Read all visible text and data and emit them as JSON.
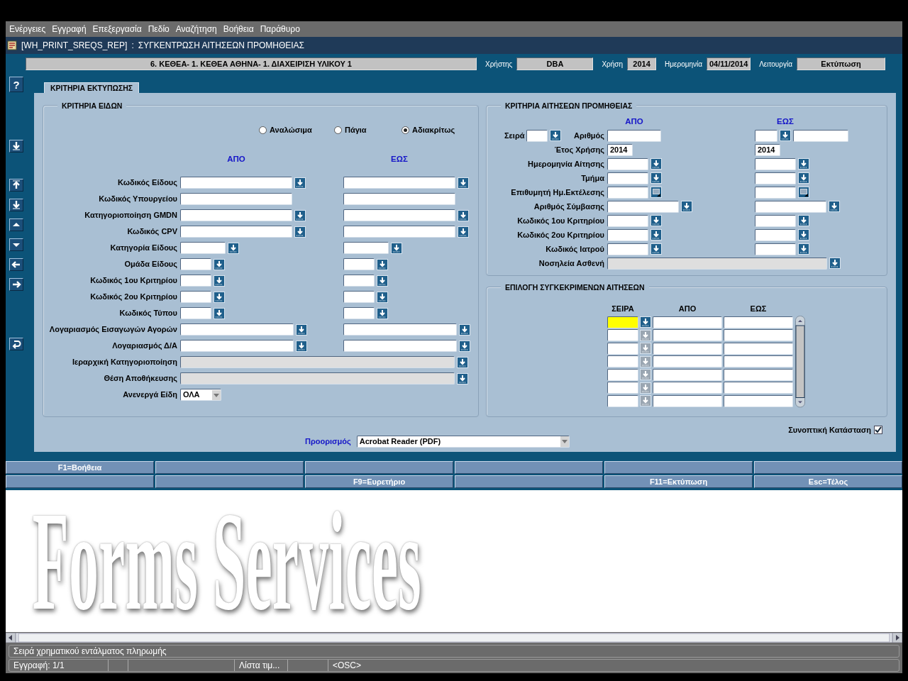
{
  "menu": [
    "Ενέργειες",
    "Εγγραφή",
    "Επεξεργασία",
    "Πεδίο",
    "Αναζήτηση",
    "Βοήθεια",
    "Παράθυρο"
  ],
  "window": {
    "form_name": "[WH_PRINT_SREQS_REP]",
    "separator": ":",
    "title": "ΣΥΓΚΕΝΤΡΩΣΗ ΑΙΤΗΣΕΩΝ ΠΡΟΜΗΘΕΙΑΣ"
  },
  "header": {
    "context": "6. ΚΕΘΕΑ- 1. ΚΕΘΕΑ ΑΘΗΝΑ- 1. ΔΙΑΧΕΙΡΙΣΗ ΥΛΙΚΟΥ 1",
    "fields": [
      {
        "label": "Χρήστης",
        "value": "DBA"
      },
      {
        "label": "Χρήση",
        "value": "2014"
      },
      {
        "label": "Ημερομηνία",
        "value": "04/11/2014"
      },
      {
        "label": "Λειτουργία",
        "value": "Εκτύπωση"
      }
    ]
  },
  "toolbar": [
    [
      {
        "kind": "help",
        "label": "?"
      }
    ],
    [
      {
        "kind": "down"
      }
    ],
    [
      {
        "kind": "up"
      },
      {
        "kind": "down"
      },
      {
        "kind": "prev"
      },
      {
        "kind": "next"
      },
      {
        "kind": "left"
      },
      {
        "kind": "right"
      }
    ],
    [
      {
        "kind": "undo"
      }
    ]
  ],
  "tab": {
    "label": "ΚΡΙΤΗΡΙΑ ΕΚΤΥΠΩΣΗΣ",
    "selected": true
  },
  "items_panel": {
    "title": "ΚΡΙΤΗΡΙΑ ΕΙΔΩΝ",
    "radios": [
      {
        "label": "Αναλώσιμα",
        "selected": false
      },
      {
        "label": "Πάγια",
        "selected": false
      },
      {
        "label": "Αδιακρίτως",
        "selected": true
      }
    ],
    "from_heading": "ΑΠΟ",
    "to_heading": "ΕΩΣ",
    "rows": [
      {
        "label": "Κωδικός Είδους",
        "kind": "range",
        "list_button": true
      },
      {
        "label": "Κωδικός Υπουργείου",
        "kind": "range",
        "list_button": false
      },
      {
        "label": "Κατηγοριοποίηση GMDN",
        "kind": "range",
        "list_button": true
      },
      {
        "label": "Κωδικός CPV",
        "kind": "range",
        "list_button": true
      },
      {
        "label": "Κατηγορία Είδους",
        "kind": "range",
        "list_button": true
      },
      {
        "label": "Ομάδα Είδους",
        "kind": "range",
        "list_button": true
      },
      {
        "label": "Κωδικός 1ου Κριτηρίου",
        "kind": "range",
        "list_button": true
      },
      {
        "label": "Κωδικός 2ου Κριτηρίου",
        "kind": "range",
        "list_button": true
      },
      {
        "label": "Κωδικός Τύπου",
        "kind": "range",
        "list_button": true
      },
      {
        "label": "Λογαριασμός Εισαγωγών Αγορών",
        "kind": "range",
        "list_button": true
      },
      {
        "label": "Λογαριασμός Δ/Α",
        "kind": "range",
        "list_button": true
      },
      {
        "label": "Ιεραρχική Κατηγοριοποίηση",
        "kind": "wide",
        "list_button": true
      },
      {
        "label": "Θέση Αποθήκευσης",
        "kind": "wide",
        "list_button": true
      },
      {
        "label": "Ανενεργά Είδη",
        "kind": "select",
        "value": "ΟΛΑ"
      }
    ]
  },
  "requests_panel": {
    "title": "ΚΡΙΤΗΡΙΑ ΑΙΤΗΣΕΩΝ ΠΡΟΜΗΘΕΙΑΣ",
    "from_heading": "ΑΠΟ",
    "to_heading": "ΕΩΣ",
    "rows": [
      {
        "label": "Σειρά",
        "second_label": "Αριθμός",
        "kind": "series"
      },
      {
        "label": "Έτος Χρήσης",
        "kind": "range",
        "from_value": "2014",
        "to_value": "2014",
        "list_button": false
      },
      {
        "label": "Ημερομηνία Αίτησης",
        "kind": "range",
        "list_button": true
      },
      {
        "label": "Τμήμα",
        "kind": "range",
        "list_button": true
      },
      {
        "label": "Επιθυμητή Ημ.Εκτέλεσης",
        "kind": "range",
        "calendar_button": true
      },
      {
        "label": "Αριθμός Σύμβασης",
        "kind": "range",
        "list_button": true
      },
      {
        "label": "Κωδικός 1ου Κριτηρίου",
        "kind": "range",
        "list_button": true
      },
      {
        "label": "Κωδικός 2ου Κριτηρίου",
        "kind": "range",
        "list_button": true
      },
      {
        "label": "Κωδικός Ιατρού",
        "kind": "range",
        "list_button": true
      },
      {
        "label": "Νοσηλεία Ασθενή",
        "kind": "wide",
        "list_button": true
      }
    ]
  },
  "selection_panel": {
    "title": "ΕΠΙΛΟΓΗ ΣΥΓΚΕΚΡΙΜΕΝΩΝ ΑΙΤΗΣΕΩΝ",
    "columns": [
      "ΣΕΙΡΑ",
      "ΑΠΟ",
      "ΕΩΣ"
    ],
    "rows": [
      {
        "selected": true
      },
      {
        "selected": false
      },
      {
        "selected": false
      },
      {
        "selected": false
      },
      {
        "selected": false
      },
      {
        "selected": false
      },
      {
        "selected": false
      }
    ]
  },
  "summary": {
    "label": "Συνοπτική Κατάσταση",
    "checked": true
  },
  "destination": {
    "label": "Προορισμός",
    "value": "Acrobat Reader (PDF)"
  },
  "function_keys": [
    {
      "kind": "key",
      "label": "F1=Βοήθεια"
    },
    {
      "kind": "blank"
    },
    {
      "kind": "blank"
    },
    {
      "kind": "blank"
    },
    {
      "kind": "blank"
    },
    {
      "kind": "blank"
    },
    {
      "kind": "blank"
    },
    {
      "kind": "blank"
    },
    {
      "kind": "key",
      "label": "F9=Ευρετήριο"
    },
    {
      "kind": "blank"
    },
    {
      "kind": "key",
      "label": "F11=Εκτύπωση"
    },
    {
      "kind": "key",
      "label": "Esc=Τέλος"
    }
  ],
  "background_logo": "Forms Services",
  "status": {
    "message": "Σειρά χρηματικού εντάλματος πληρωμής",
    "fields": [
      {
        "kind": "text",
        "text": "Εγγραφή: 1/1"
      },
      {
        "kind": "blank"
      },
      {
        "kind": "blank"
      },
      {
        "kind": "text",
        "text": "Λίστα τιμ..."
      },
      {
        "kind": "blank"
      },
      {
        "kind": "text",
        "text": "<OSC>"
      }
    ]
  }
}
